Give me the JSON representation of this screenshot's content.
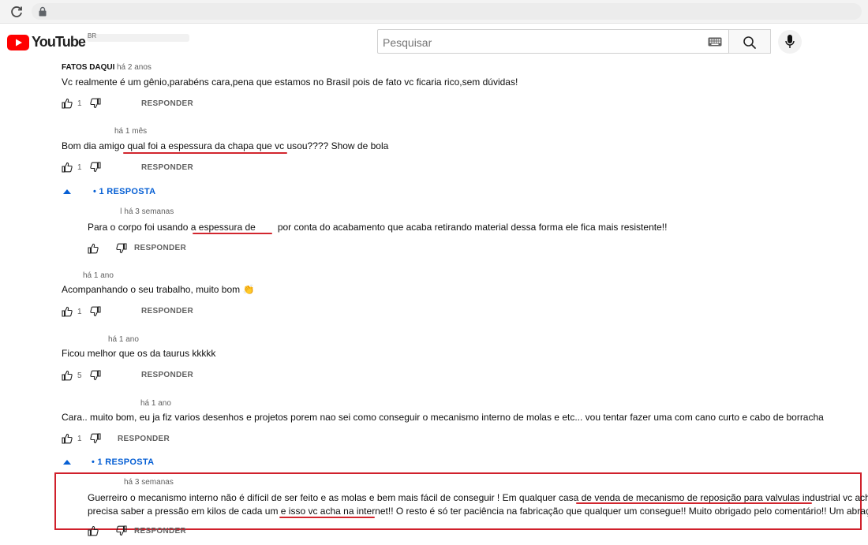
{
  "search": {
    "placeholder": "Pesquisar"
  },
  "logo": {
    "wordmark": "YouTube",
    "region": "BR"
  },
  "reply_label": "RESPONDER",
  "comments": [
    {
      "author": "FATOS DAQUI",
      "time": "há 2 anos",
      "text": "Vc realmente é um gênio,parabéns cara,pena que estamos no Brasil pois de fato vc ficaria rico,sem dúvidas!",
      "likes": "1"
    },
    {
      "author": "",
      "time": "há 1 mês",
      "text_before": "Bom dia amigo ",
      "text_underlined": "qual foi a espessura da chapa que vc us",
      "text_after": "ou???? Show de bola",
      "likes": "1",
      "replies_toggle": "• 1 RESPOSTA"
    },
    {
      "author": "",
      "time": "há 3 semanas",
      "text_before": "Para o corpo foi usando a ",
      "text_underlined": "espessura de",
      "text_after": "por conta do acabamento que acaba retirando material dessa forma ele fica mais resistente!!",
      "likes": ""
    },
    {
      "author": "",
      "time": "há 1 ano",
      "text": "Acompanhando o seu trabalho, muito bom 👏",
      "likes": "1"
    },
    {
      "author": "",
      "time": "há 1 ano",
      "text": "Ficou melhor que os da taurus kkkkk",
      "likes": "5"
    },
    {
      "author": "",
      "time": "há 1 ano",
      "text": "Cara.. muito bom, eu ja fiz varios desenhos e projetos porem nao sei como conseguir o mecanismo interno de molas e etc... vou tentar fazer uma com cano curto e cabo de borracha",
      "likes": "1",
      "replies_toggle": "• 1 RESPOSTA"
    },
    {
      "author": "",
      "time": "há 3 semanas",
      "line1_before": "Guerreiro o mecanismo interno não é difícil de ser feito e as molas e bem mais fácil de conseguir ! Em qualquer casa de ",
      "line1_underlined": "venda de mecanismo de reposição para valvulas industrial",
      "line1_after": " vc acha só",
      "line2_before": "precisa saber a pressão em kilos de cada um e ",
      "line2_underlined": "isso vc acha na internet",
      "line2_after": "!! O resto é só ter paciência na fabricação que qualquer um consegue!! Muito obrigado pelo comentário!! Um abraço!!",
      "likes": ""
    }
  ],
  "colors": {
    "annotation_red": "#d0202b",
    "link_blue": "#065fd4",
    "logo_red": "#ff0000"
  }
}
